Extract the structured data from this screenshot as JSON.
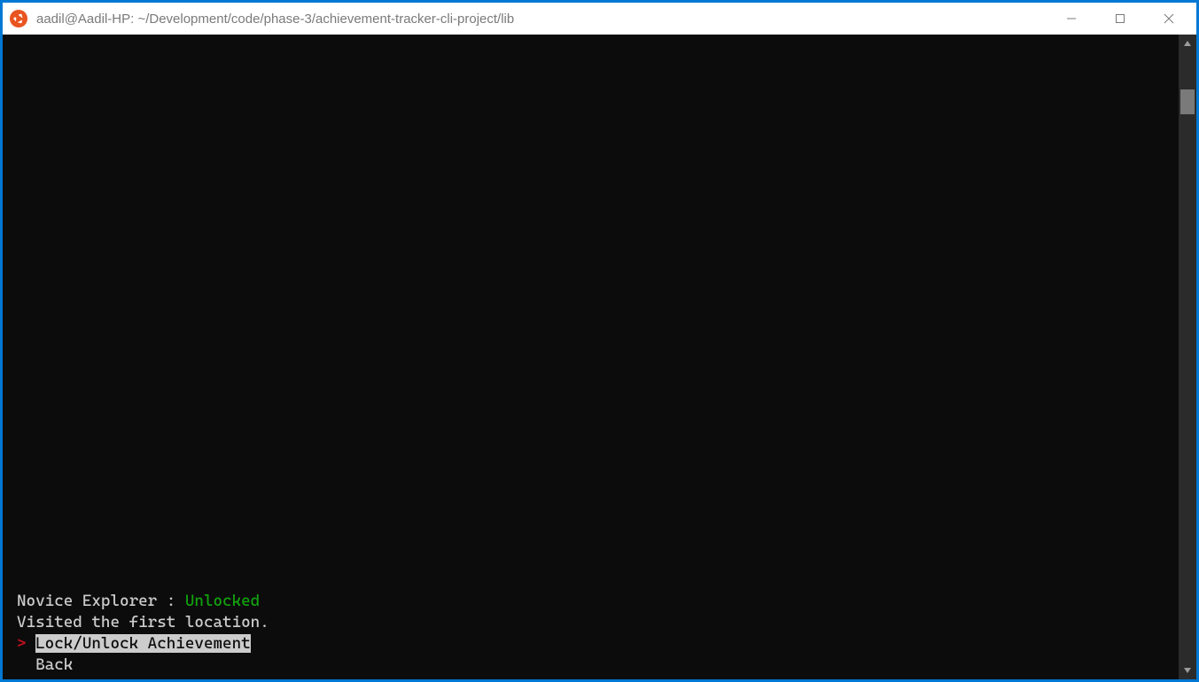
{
  "titlebar": {
    "title": "aadil@Aadil-HP: ~/Development/code/phase-3/achievement-tracker-cli-project/lib"
  },
  "terminal": {
    "achievement_name": "Novice Explorer",
    "status_separator": " : ",
    "status_text": "Unlocked",
    "description": "Visited the first location.",
    "prompt_marker": "> ",
    "menu": {
      "selected": "Lock/Unlock Achievement",
      "back": "Back"
    },
    "indent": "  "
  },
  "colors": {
    "accent": "#0078d4",
    "terminal_bg": "#0c0c0c",
    "terminal_fg": "#cccccc",
    "green": "#13a10e",
    "red": "#c50f1f",
    "ubuntu_orange": "#e95420"
  }
}
